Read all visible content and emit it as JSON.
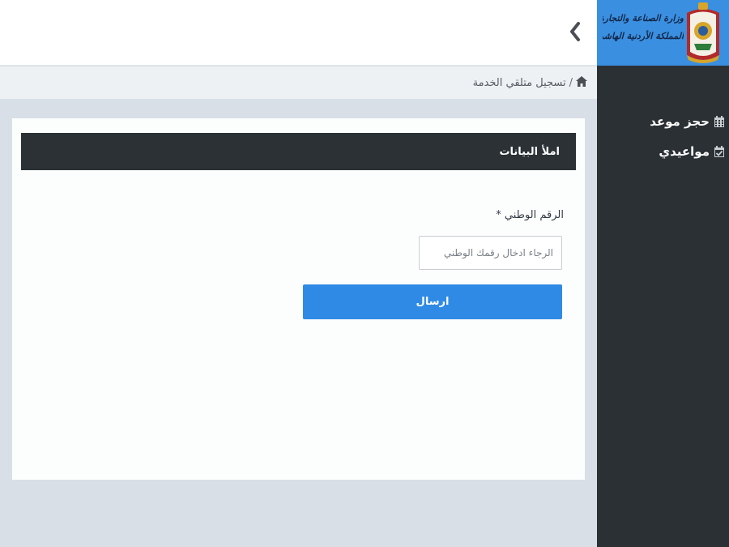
{
  "sidebar": {
    "ministry_line1": "وزارة الصناعة والتجارة والتموين",
    "ministry_line2": "المملكة الأردنية الهاشمية",
    "items": [
      {
        "label": "حجز موعد",
        "icon": "calendar-icon"
      },
      {
        "label": "مواعيدي",
        "icon": "calendar-check-icon"
      }
    ]
  },
  "breadcrumb": {
    "home_icon": "home-icon",
    "separator": "/",
    "current": "تسجيل متلقي الخدمة"
  },
  "form": {
    "header": "املأ البيانات",
    "national_id_label": "الرقم الوطني",
    "required_mark": "*",
    "national_id_placeholder": "الرجاء ادخال رقمك الوطني",
    "national_id_value": "",
    "submit_label": "ارسال"
  },
  "colors": {
    "accent": "#2f8ae5",
    "logo_bg": "#3a8fe0",
    "sidebar_bg": "#2b3035",
    "header_bg": "#2b3135",
    "page_bg": "#d9dfe6"
  }
}
